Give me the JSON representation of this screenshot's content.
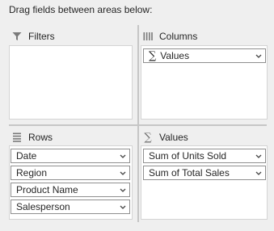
{
  "instruction": "Drag fields between areas below:",
  "areas": {
    "filters": {
      "label": "Filters",
      "icon": "filter-icon",
      "fields": []
    },
    "columns": {
      "label": "Columns",
      "icon": "columns-icon",
      "fields": [
        {
          "label": "Values"
        }
      ]
    },
    "rows": {
      "label": "Rows",
      "icon": "rows-icon",
      "fields": [
        {
          "label": "Date"
        },
        {
          "label": "Region"
        },
        {
          "label": "Product Name"
        },
        {
          "label": "Salesperson"
        }
      ]
    },
    "values": {
      "label": "Values",
      "icon": "sigma-icon",
      "fields": [
        {
          "label": "Sum of Units Sold"
        },
        {
          "label": "Sum of Total Sales"
        }
      ]
    }
  },
  "colors": {
    "background": "#efefef",
    "box": "#ffffff",
    "border": "#8f8f8f",
    "icon": "#6b6b6b"
  }
}
